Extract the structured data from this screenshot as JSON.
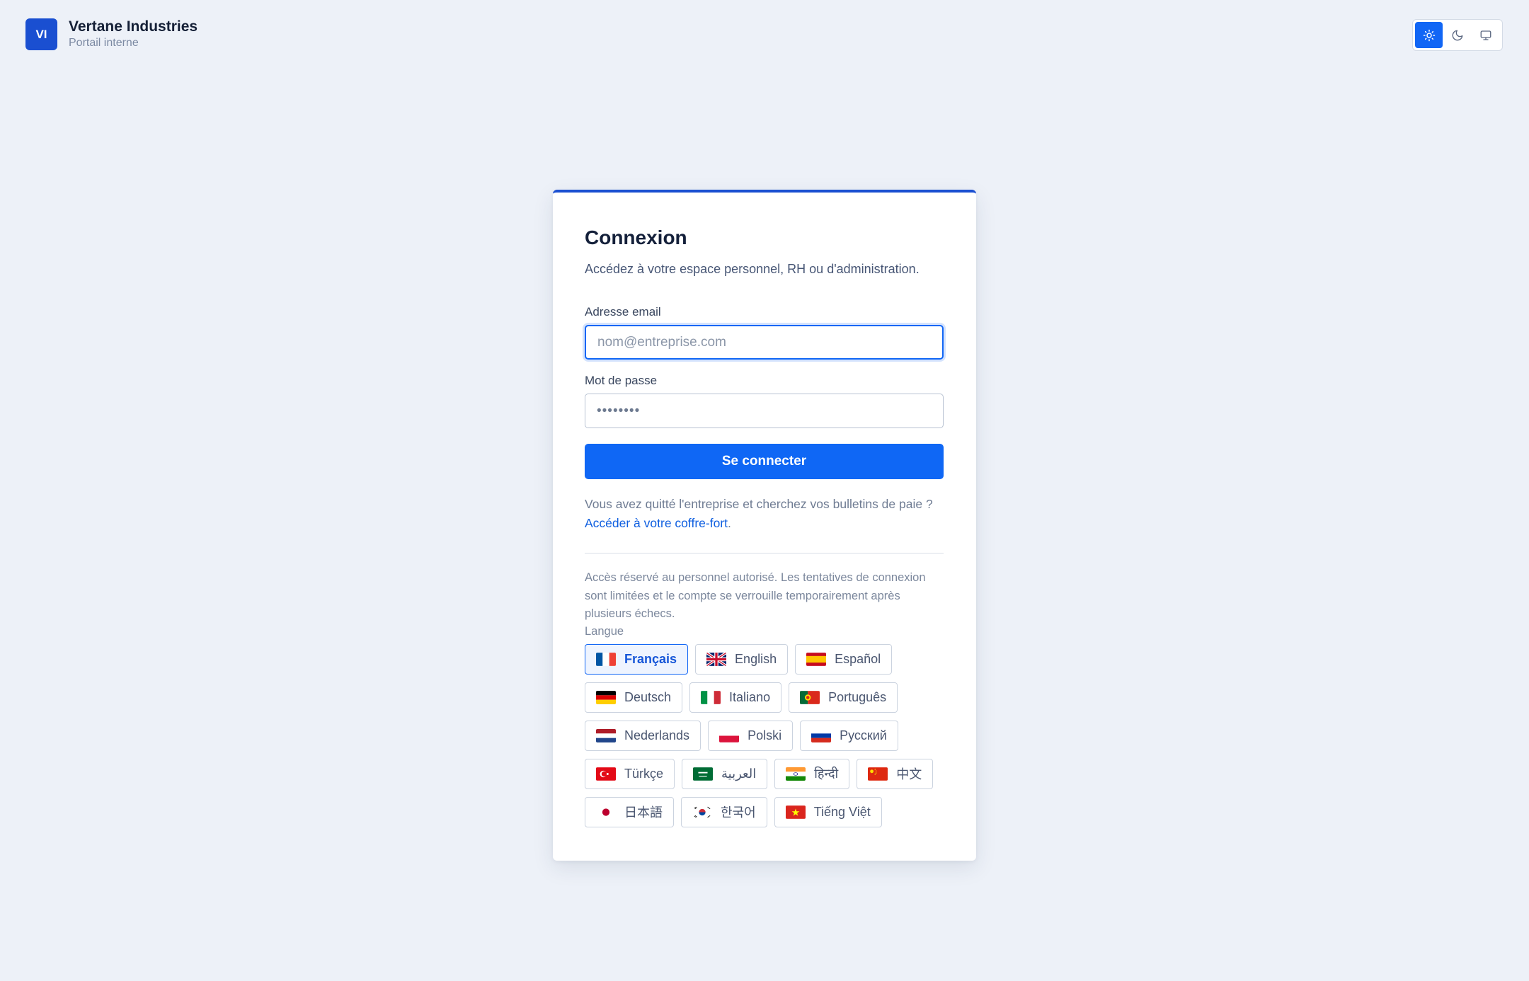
{
  "brand": {
    "logo_initials": "VI",
    "name": "Vertane Industries",
    "subtitle": "Portail interne"
  },
  "theme_switcher": {
    "options": [
      {
        "icon": "sun-icon",
        "active": true
      },
      {
        "icon": "moon-icon",
        "active": false
      },
      {
        "icon": "monitor-icon",
        "active": false
      }
    ]
  },
  "login": {
    "title": "Connexion",
    "subtitle": "Accédez à votre espace personnel, RH ou d'administration.",
    "email_label": "Adresse email",
    "email_placeholder": "nom@entreprise.com",
    "password_label": "Mot de passe",
    "password_value": "••••••••",
    "submit_label": "Se connecter",
    "left_question": "Vous avez quitté l'entreprise et cherchez vos bulletins de paie ?",
    "vault_link": "Accéder à votre coffre-fort",
    "vault_link_suffix": ".",
    "notice": "Accès réservé au personnel autorisé. Les tentatives de connexion sont limitées et le compte se verrouille temporairement après plusieurs échecs.",
    "language_label": "Langue"
  },
  "languages": [
    {
      "label": "Français",
      "flag": "fr",
      "active": true
    },
    {
      "label": "English",
      "flag": "gb"
    },
    {
      "label": "Español",
      "flag": "es"
    },
    {
      "label": "Deutsch",
      "flag": "de"
    },
    {
      "label": "Italiano",
      "flag": "it"
    },
    {
      "label": "Português",
      "flag": "pt"
    },
    {
      "label": "Nederlands",
      "flag": "nl"
    },
    {
      "label": "Polski",
      "flag": "pl"
    },
    {
      "label": "Русский",
      "flag": "ru"
    },
    {
      "label": "Türkçe",
      "flag": "tr"
    },
    {
      "label": "العربية",
      "flag": "sa"
    },
    {
      "label": "हिन्दी",
      "flag": "in"
    },
    {
      "label": "中文",
      "flag": "cn"
    },
    {
      "label": "日本語",
      "flag": "jp"
    },
    {
      "label": "한국어",
      "flag": "kr"
    },
    {
      "label": "Tiếng Việt",
      "flag": "vn"
    }
  ],
  "colors": {
    "accent": "#1166f5",
    "brand": "#1a4fd1",
    "background": "#edf1f8"
  }
}
